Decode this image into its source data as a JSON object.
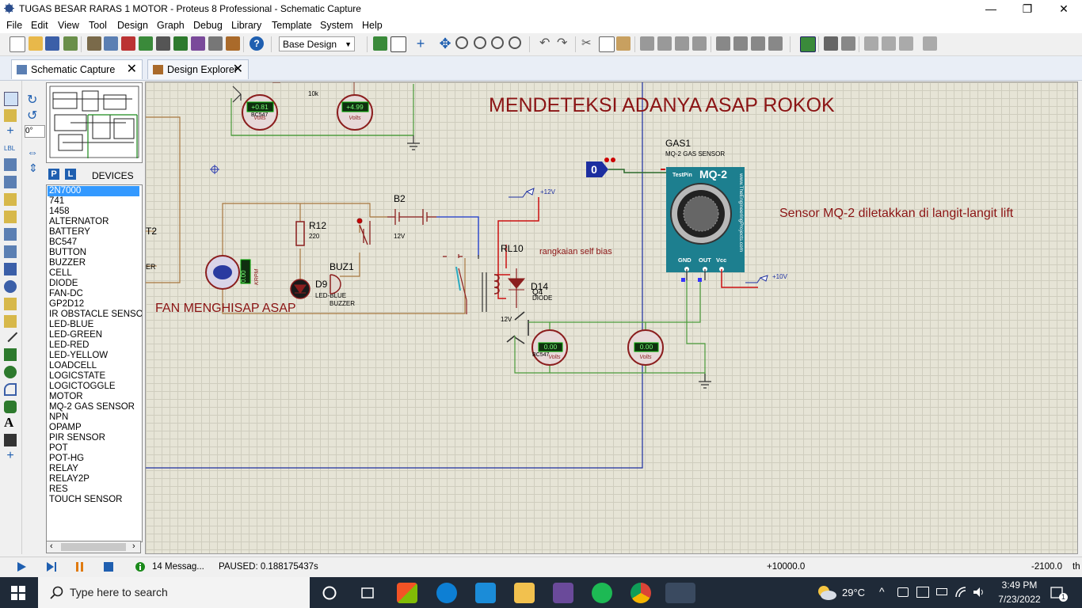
{
  "window": {
    "title": "TUGAS BESAR RARAS 1 MOTOR - Proteus 8 Professional - Schematic Capture",
    "minimize": "—",
    "maximize": "❐",
    "close": "✕"
  },
  "menu": [
    "File",
    "Edit",
    "View",
    "Tool",
    "Design",
    "Graph",
    "Debug",
    "Library",
    "Template",
    "System",
    "Help"
  ],
  "toolbar": {
    "design_select": "Base Design"
  },
  "tabs": [
    {
      "label": "Schematic Capture",
      "active": true
    },
    {
      "label": "Design Explorer",
      "active": false
    }
  ],
  "left_panel": {
    "rotation": "0°",
    "picker_p": "P",
    "picker_l": "L",
    "devices_title": "DEVICES",
    "devices": [
      "2N7000",
      "741",
      "1458",
      "ALTERNATOR",
      "BATTERY",
      "BC547",
      "BUTTON",
      "BUZZER",
      "CELL",
      "DIODE",
      "FAN-DC",
      "GP2D12",
      "IR OBSTACLE SENSOR",
      "LED-BLUE",
      "LED-GREEN",
      "LED-RED",
      "LED-YELLOW",
      "LOADCELL",
      "LOGICSTATE",
      "LOGICTOGGLE",
      "MOTOR",
      "MQ-2 GAS SENSOR",
      "NPN",
      "OPAMP",
      "PIR SENSOR",
      "POT",
      "POT-HG",
      "RELAY",
      "RELAY2P",
      "RES",
      "TOUCH SENSOR"
    ],
    "selected_device": "2N7000"
  },
  "schematic": {
    "heading": "MENDETEKSI ADANYA ASAP ROKOK",
    "fan_label": "FAN MENGHISAP ASAP",
    "sensor_note": "Sensor MQ-2 diletakkan di langit-langit lift",
    "self_bias": "rangkaian self bias",
    "gas_ref": "GAS1",
    "gas_name": "MQ-2 GAS SENSOR",
    "mq2_title": "MQ-2",
    "mq2_testpin": "TestPin",
    "mq2_site": "www.TheEngineeringProjects.com",
    "mq2_pins": [
      "GND",
      "OUT",
      "Vcc"
    ],
    "logic_state": "0",
    "b2": "B2",
    "b2_volt": "12V",
    "r12": "R12",
    "r12_val": "220",
    "r_top_val": "10k",
    "buz1": "BUZ1",
    "buz1_type": "BUZZER",
    "d9": "D9",
    "d9_type": "LED-BLUE",
    "rl10": "RL10",
    "rl10_volt": "12V",
    "d14": "D14",
    "d14_type": "DIODE",
    "q4": "Q4",
    "q_type": "BC547",
    "v12": "+12V",
    "v10": "+10V",
    "motor_unit": "KRPM",
    "motor_reading": "0.00",
    "volt_unit": "Volts",
    "meter_top_left": "+0.81",
    "meter_top_right": "+4.99",
    "meter_bottom_left": "0.00",
    "meter_bottom_right": "0.00",
    "clipped_label_1": "T2",
    "clipped_label_2": "ER"
  },
  "status": {
    "messages": "14 Messag...",
    "paused": "PAUSED: 0.188175437s",
    "coord_x": "+10000.0",
    "coord_y": "-2100.0",
    "unit": "th"
  },
  "taskbar": {
    "search_placeholder": "Type here to search",
    "weather": "29°C",
    "time": "3:49 PM",
    "date": "7/23/2022",
    "notifications": "1"
  }
}
